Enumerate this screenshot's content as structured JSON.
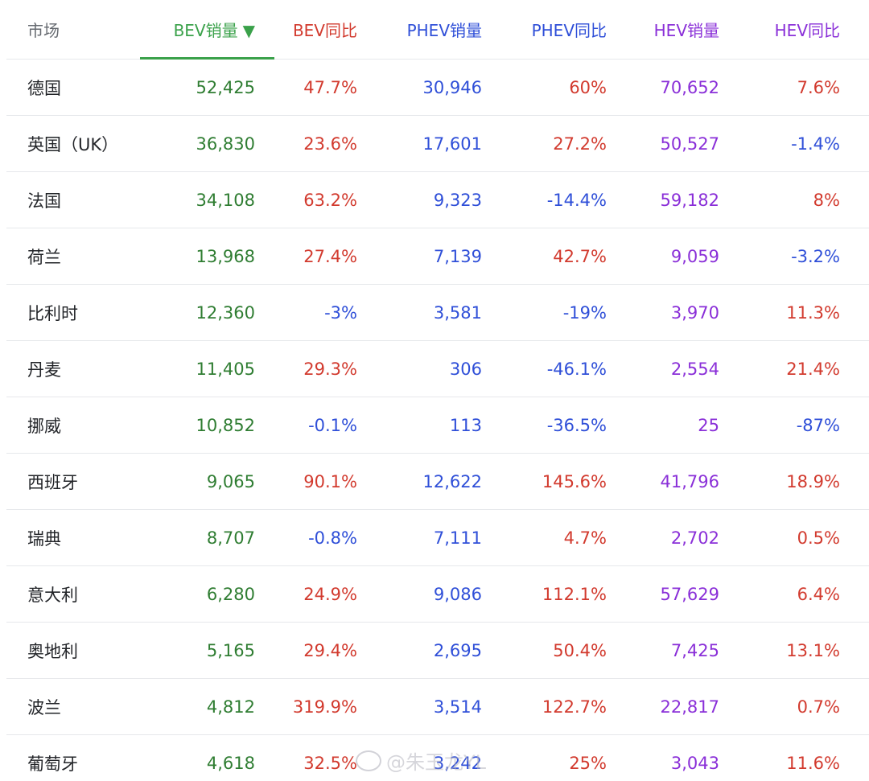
{
  "table": {
    "headers": {
      "market": "市场",
      "bev_sales": "BEV销量",
      "bev_sort_arrow": "▼",
      "bev_yoy": "BEV同比",
      "phev_sales": "PHEV销量",
      "phev_yoy": "PHEV同比",
      "hev_sales": "HEV销量",
      "hev_yoy": "HEV同比"
    },
    "sorted_by": "BEV销量",
    "sort_direction": "descending",
    "rows": [
      {
        "market": "德国",
        "bev_sales": "52,425",
        "bev_yoy": "47.7%",
        "phev_sales": "30,946",
        "phev_yoy": "60%",
        "hev_sales": "70,652",
        "hev_yoy": "7.6%"
      },
      {
        "market": "英国（UK）",
        "bev_sales": "36,830",
        "bev_yoy": "23.6%",
        "phev_sales": "17,601",
        "phev_yoy": "27.2%",
        "hev_sales": "50,527",
        "hev_yoy": "-1.4%"
      },
      {
        "market": "法国",
        "bev_sales": "34,108",
        "bev_yoy": "63.2%",
        "phev_sales": "9,323",
        "phev_yoy": "-14.4%",
        "hev_sales": "59,182",
        "hev_yoy": "8%"
      },
      {
        "market": "荷兰",
        "bev_sales": "13,968",
        "bev_yoy": "27.4%",
        "phev_sales": "7,139",
        "phev_yoy": "42.7%",
        "hev_sales": "9,059",
        "hev_yoy": "-3.2%"
      },
      {
        "market": "比利时",
        "bev_sales": "12,360",
        "bev_yoy": "-3%",
        "phev_sales": "3,581",
        "phev_yoy": "-19%",
        "hev_sales": "3,970",
        "hev_yoy": "11.3%"
      },
      {
        "market": "丹麦",
        "bev_sales": "11,405",
        "bev_yoy": "29.3%",
        "phev_sales": "306",
        "phev_yoy": "-46.1%",
        "hev_sales": "2,554",
        "hev_yoy": "21.4%"
      },
      {
        "market": "挪威",
        "bev_sales": "10,852",
        "bev_yoy": "-0.1%",
        "phev_sales": "113",
        "phev_yoy": "-36.5%",
        "hev_sales": "25",
        "hev_yoy": "-87%"
      },
      {
        "market": "西班牙",
        "bev_sales": "9,065",
        "bev_yoy": "90.1%",
        "phev_sales": "12,622",
        "phev_yoy": "145.6%",
        "hev_sales": "41,796",
        "hev_yoy": "18.9%"
      },
      {
        "market": "瑞典",
        "bev_sales": "8,707",
        "bev_yoy": "-0.8%",
        "phev_sales": "7,111",
        "phev_yoy": "4.7%",
        "hev_sales": "2,702",
        "hev_yoy": "0.5%"
      },
      {
        "market": "意大利",
        "bev_sales": "6,280",
        "bev_yoy": "24.9%",
        "phev_sales": "9,086",
        "phev_yoy": "112.1%",
        "hev_sales": "57,629",
        "hev_yoy": "6.4%"
      },
      {
        "market": "奥地利",
        "bev_sales": "5,165",
        "bev_yoy": "29.4%",
        "phev_sales": "2,695",
        "phev_yoy": "50.4%",
        "hev_sales": "7,425",
        "hev_yoy": "13.1%"
      },
      {
        "market": "波兰",
        "bev_sales": "4,812",
        "bev_yoy": "319.9%",
        "phev_sales": "3,514",
        "phev_yoy": "122.7%",
        "hev_sales": "22,817",
        "hev_yoy": "0.7%"
      },
      {
        "market": "葡萄牙",
        "bev_sales": "4,618",
        "bev_yoy": "32.5%",
        "phev_sales": "3,242",
        "phev_yoy": "25%",
        "hev_sales": "3,043",
        "hev_yoy": "11.6%"
      }
    ]
  },
  "watermark": {
    "text": "@朱玉龙YL",
    "icon": "weibo-icon"
  },
  "colors": {
    "bev": "#2f7d32",
    "bev_header": "#3aa14a",
    "positive": "#d23a2e",
    "negative": "#2f4fd8",
    "phev": "#2f4fd8",
    "hev": "#8a2fd8",
    "market": "#222428",
    "header_market": "#666a70",
    "divider": "#e6e8eb"
  }
}
